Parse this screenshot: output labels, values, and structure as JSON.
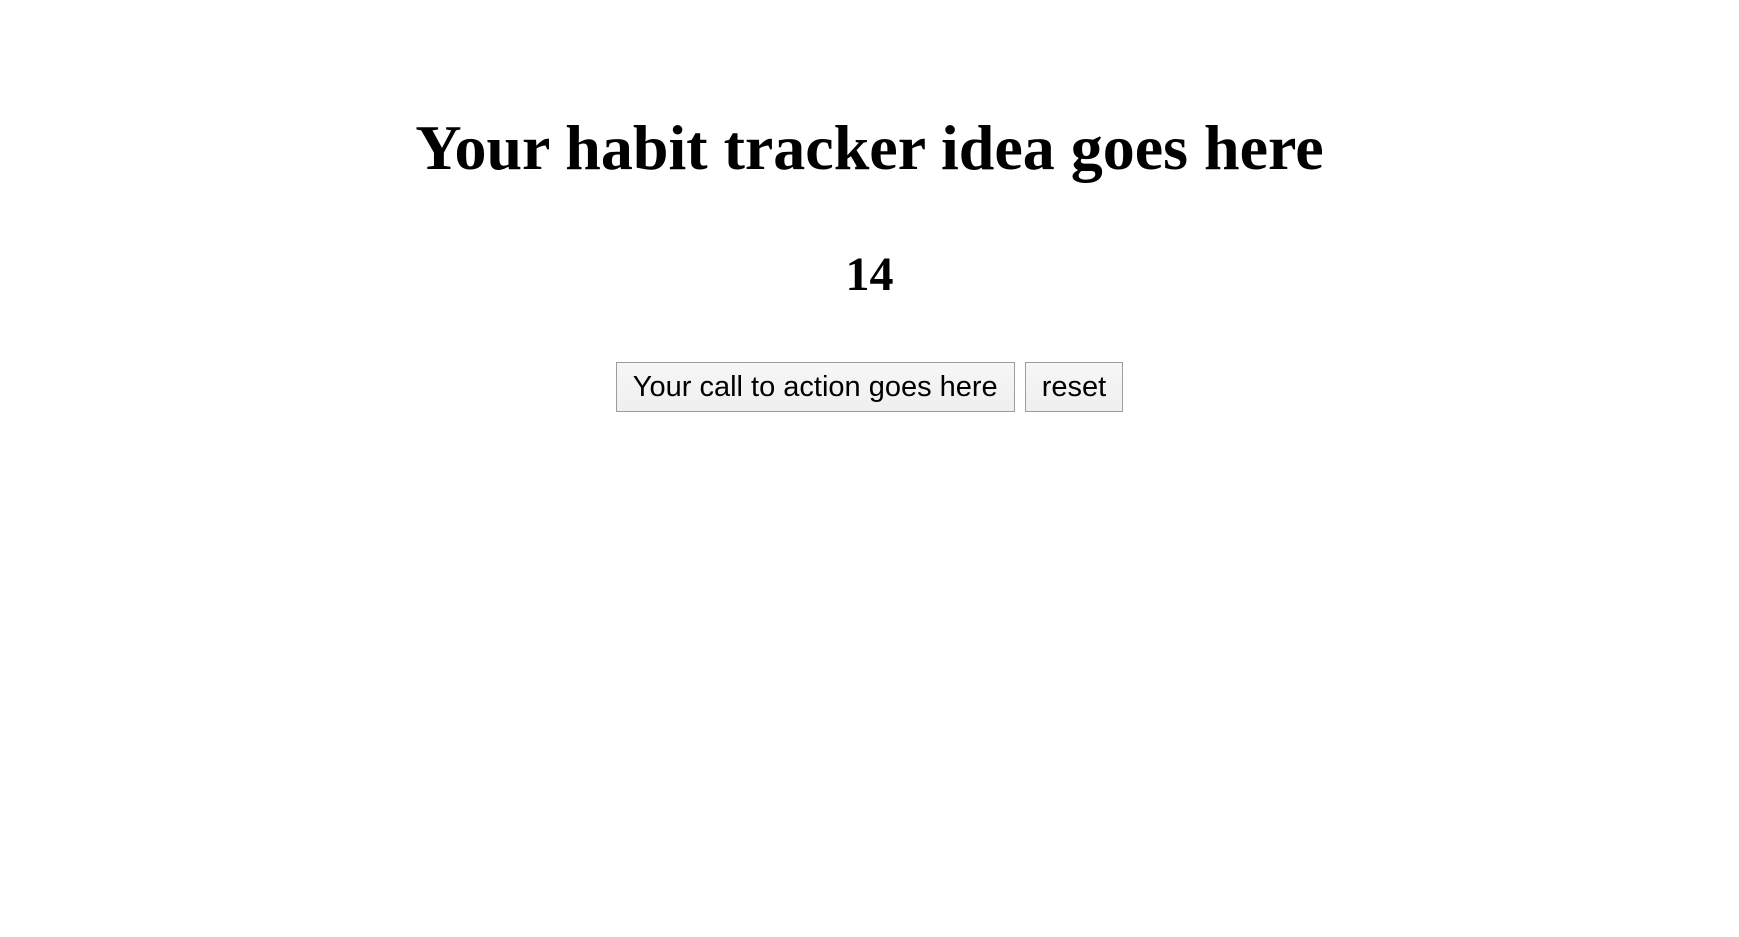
{
  "main": {
    "title": "Your habit tracker idea goes here",
    "count": "14",
    "cta_label": "Your call to action goes here",
    "reset_label": "reset"
  }
}
